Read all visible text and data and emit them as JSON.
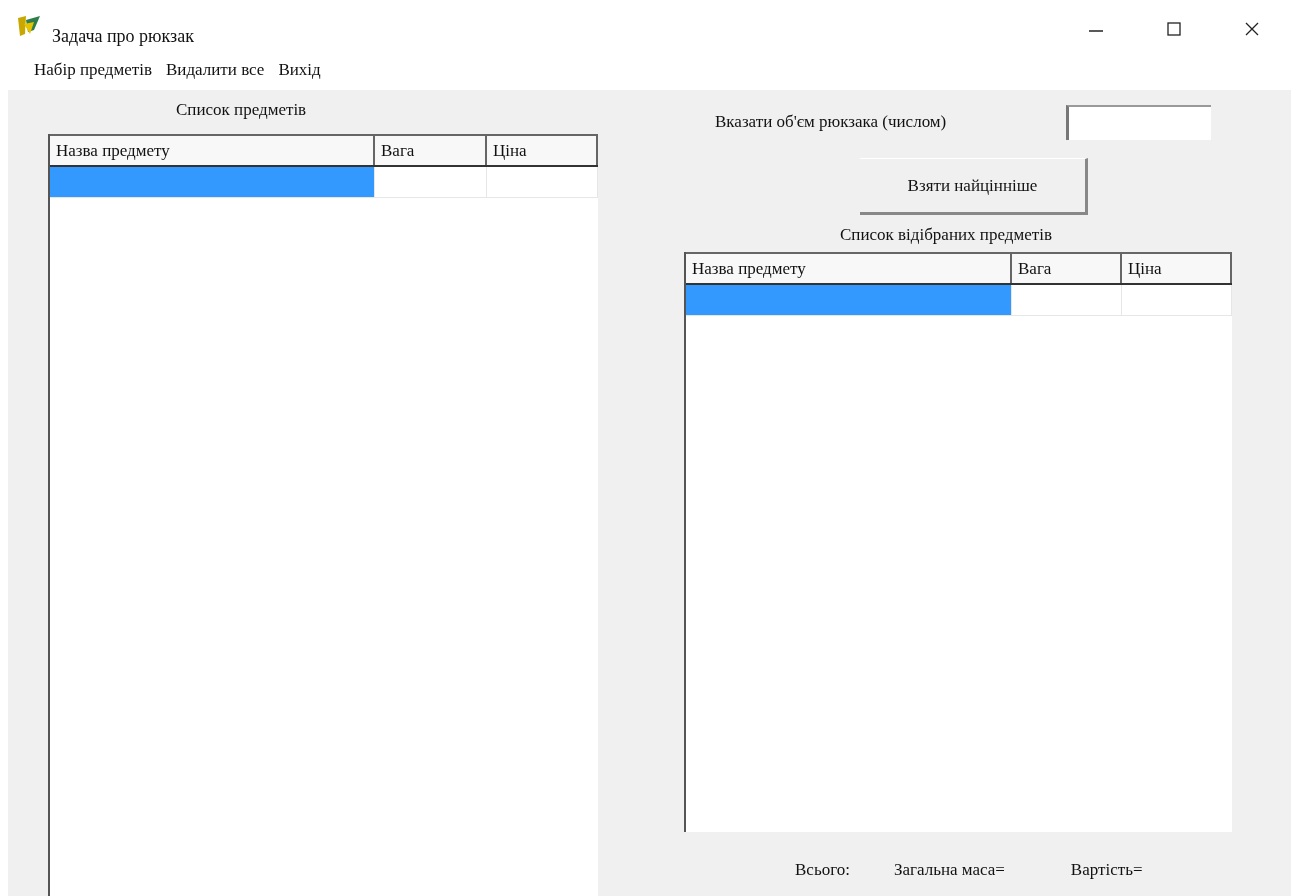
{
  "window": {
    "title": "Задача про рюкзак"
  },
  "menu": [
    "Набір предметів",
    "Видалити все",
    "Вихід"
  ],
  "items_list": {
    "caption": "Список предметів",
    "columns": [
      "Назва предмету",
      "Вага",
      "Ціна"
    ],
    "rows": [
      {
        "selected": true
      }
    ]
  },
  "capacity": {
    "label": "Вказати об'єм рюкзака (числом)"
  },
  "take_button": "Взяти найцінніше",
  "selected_list": {
    "caption": "Список відібраних предметів",
    "columns": [
      "Назва предмету",
      "Вага",
      "Ціна"
    ],
    "rows": [
      {
        "selected": true
      }
    ]
  },
  "totals": [
    "Всього:",
    "Загальна маса=",
    "Вартість="
  ]
}
